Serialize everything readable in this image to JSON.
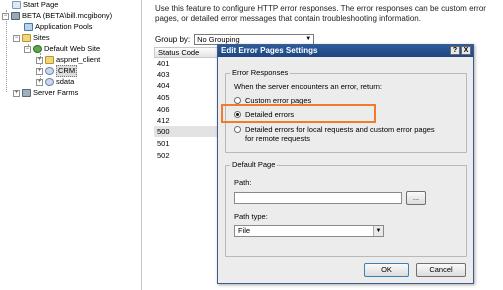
{
  "tree": {
    "start_page": "Start Page",
    "server": "BETA (BETA\\bill.mcgibony)",
    "app_pools": "Application Pools",
    "sites": "Sites",
    "default_web_site": "Default Web Site",
    "aspnet_client": "aspnet_client",
    "crm": "CRM",
    "sdata": "sdata",
    "server_farms": "Server Farms"
  },
  "main": {
    "description": "Use this feature to configure HTTP error responses. The error responses can be custom error pages, or detailed error messages that contain troubleshooting information.",
    "group_by_label": "Group by:",
    "group_by_value": "No Grouping",
    "status_code_header": "Status Code",
    "status_codes": [
      "401",
      "403",
      "404",
      "405",
      "406",
      "412",
      "500",
      "501",
      "502"
    ]
  },
  "dialog": {
    "title": "Edit Error Pages Settings",
    "help_btn": "?",
    "close_btn": "X",
    "error_responses_legend": "Error Responses",
    "when_error_text": "When the server encounters an error, return:",
    "opt_custom": "Custom error pages",
    "opt_detailed": "Detailed errors",
    "opt_local_line1": "Detailed errors for local requests and custom error pages",
    "opt_local_line2": "for remote requests",
    "default_page_legend": "Default Page",
    "path_label": "Path:",
    "path_value": "",
    "browse_label": "...",
    "path_type_label": "Path type:",
    "path_type_value": "File",
    "ok_label": "OK",
    "cancel_label": "Cancel"
  },
  "colors": {
    "titlebar": "#1e4680",
    "highlight": "#f27a2d"
  }
}
